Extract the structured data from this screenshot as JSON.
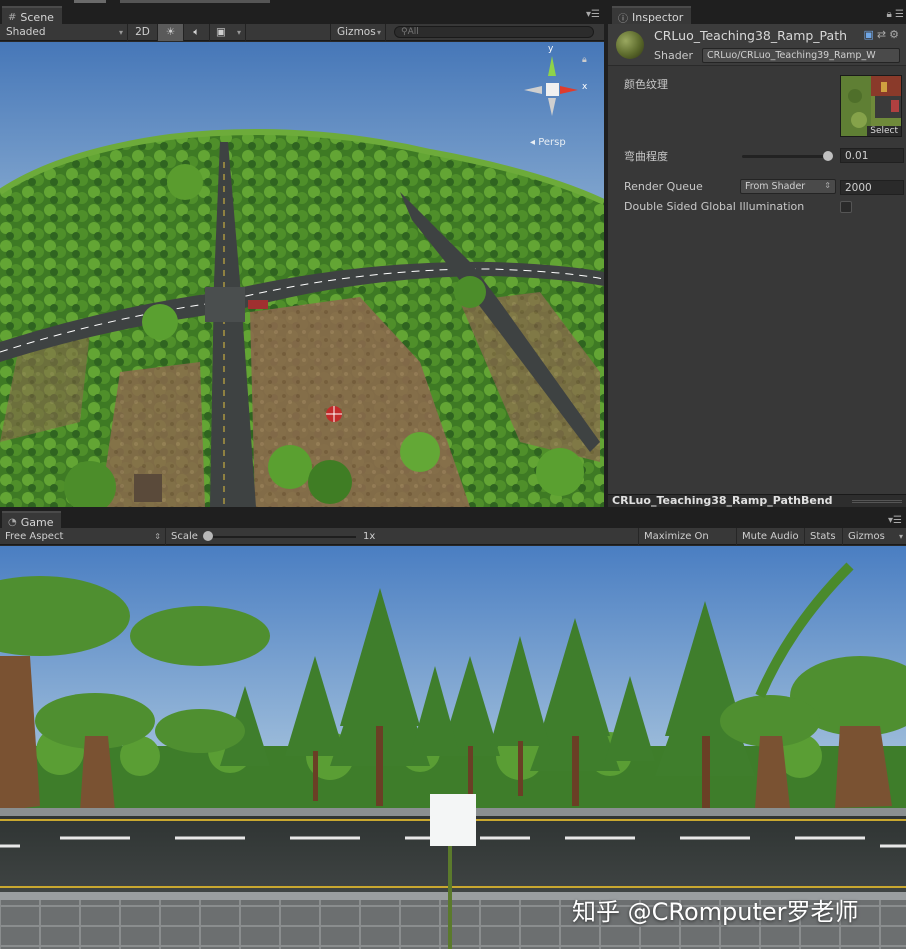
{
  "scene": {
    "tab_label": "Scene",
    "shading_mode": "Shaded",
    "mode_2d": "2D",
    "gizmos_label": "Gizmos",
    "search_placeholder": "All",
    "gizmo_y_axis": "y",
    "gizmo_x_axis": "x",
    "projection_label": "Persp"
  },
  "inspector": {
    "tab_label": "Inspector",
    "material_name": "CRLuo_Teaching38_Ramp_Path",
    "shader_label": "Shader",
    "shader_value": "CRLuo/CRLuo_Teaching39_Ramp_W",
    "properties": {
      "color_texture_label": "颜色纹理",
      "texture_select_label": "Select",
      "curvature_label": "弯曲程度",
      "curvature_value": "0.01",
      "curvature_slider_fraction": 0.95,
      "render_queue_label": "Render Queue",
      "render_queue_mode": "From Shader",
      "render_queue_value": "2000",
      "double_sided_gi_label": "Double Sided Global Illumination",
      "double_sided_gi_checked": false
    },
    "footer_title": "CRLuo_Teaching38_Ramp_PathBend"
  },
  "game": {
    "tab_label": "Game",
    "aspect": "Free Aspect",
    "scale_label": "Scale",
    "scale_value": "1x",
    "maximize_on_play": "Maximize On Play",
    "mute_audio": "Mute Audio",
    "stats": "Stats",
    "gizmos": "Gizmos"
  },
  "watermark": "知乎 @CRomputer罗老师",
  "colors": {
    "editor_dark": "#282828",
    "panel": "#383838",
    "sky_top": "#4d7fc0",
    "grass": "#4f8a2a",
    "road": "#3a3d3c"
  }
}
